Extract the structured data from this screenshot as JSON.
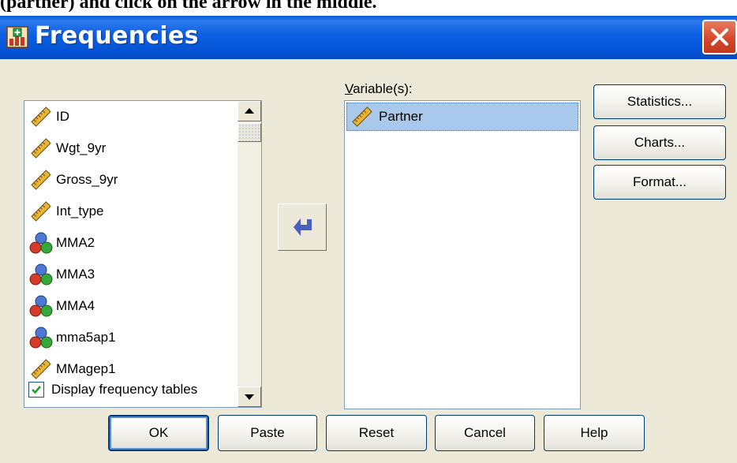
{
  "context_text_visible": "(partner) and click on the arrow in the middle.",
  "window": {
    "title": "Frequencies"
  },
  "source_list": {
    "items": [
      {
        "label": "ID",
        "icon": "scale-ruler-icon"
      },
      {
        "label": "Wgt_9yr",
        "icon": "scale-ruler-icon"
      },
      {
        "label": "Gross_9yr",
        "icon": "scale-ruler-icon"
      },
      {
        "label": "Int_type",
        "icon": "scale-ruler-icon"
      },
      {
        "label": "MMA2",
        "icon": "nominal-balls-icon"
      },
      {
        "label": "MMA3",
        "icon": "nominal-balls-icon"
      },
      {
        "label": "MMA4",
        "icon": "nominal-balls-icon"
      },
      {
        "label": "mma5ap1",
        "icon": "nominal-balls-icon"
      },
      {
        "label": "MMagep1",
        "icon": "scale-ruler-icon"
      }
    ]
  },
  "target": {
    "label": "Variable(s):",
    "items": [
      {
        "label": "Partner",
        "icon": "scale-ruler-icon",
        "selected": true
      }
    ]
  },
  "side_buttons": {
    "statistics": "Statistics...",
    "charts": "Charts...",
    "format": "Format..."
  },
  "checkbox": {
    "label": "Display frequency tables",
    "checked": true
  },
  "bottom_buttons": {
    "ok": "OK",
    "paste": "Paste",
    "reset": "Reset",
    "cancel": "Cancel",
    "help": "Help"
  },
  "colors": {
    "titlebar": "#0554d6",
    "dialog_bg": "#ece9d8",
    "selection": "#a9c9ec",
    "close": "#d4442a"
  }
}
